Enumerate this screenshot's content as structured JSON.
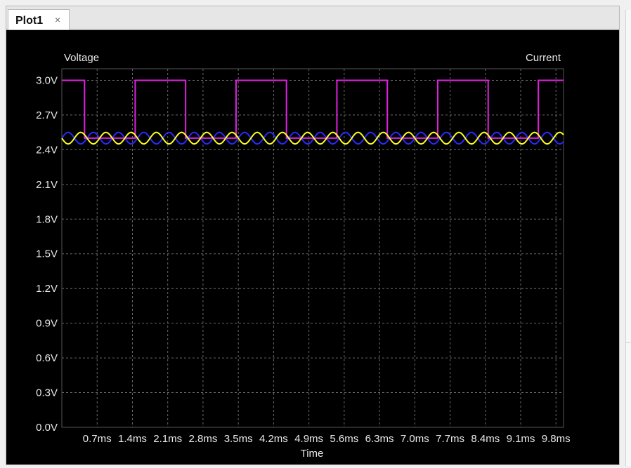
{
  "tab": {
    "label": "Plot1",
    "close_glyph": "×"
  },
  "chart_data": {
    "type": "line",
    "left_axis_label": "Voltage",
    "right_axis_label": "Current",
    "xlabel": "Time",
    "xlim": [
      0,
      9.95
    ],
    "ylim": [
      0,
      3.1
    ],
    "x_ticks": [
      0.7,
      1.4,
      2.1,
      2.8,
      3.5,
      4.2,
      4.9,
      5.6,
      6.3,
      7.0,
      7.7,
      8.4,
      9.1,
      9.8
    ],
    "x_tick_labels": [
      "0.7ms",
      "1.4ms",
      "2.1ms",
      "2.8ms",
      "3.5ms",
      "4.2ms",
      "4.9ms",
      "5.6ms",
      "6.3ms",
      "7.0ms",
      "7.7ms",
      "8.4ms",
      "9.1ms",
      "9.8ms"
    ],
    "y_ticks": [
      0,
      0.3,
      0.6,
      0.9,
      1.2,
      1.5,
      1.8,
      2.1,
      2.4,
      2.7,
      3.0
    ],
    "y_tick_labels": [
      "0.0V",
      "0.3V",
      "0.6V",
      "0.9V",
      "1.2V",
      "1.5V",
      "1.8V",
      "2.1V",
      "2.4V",
      "2.7V",
      "3.0V"
    ],
    "grid": true,
    "background": "#000000",
    "series": [
      {
        "color": "#e020e0",
        "kind": "pwm",
        "low": 2.5,
        "high": 3.0,
        "period": 2.0,
        "duty": 0.5,
        "phase": 1.45
      },
      {
        "color": "#2a2aff",
        "kind": "sine",
        "offset": 2.5,
        "amplitude": 0.05,
        "period": 0.5,
        "phase": 0.0
      },
      {
        "color": "#ffff20",
        "kind": "sine",
        "offset": 2.5,
        "amplitude": 0.05,
        "period": 0.5,
        "phase": 0.25
      }
    ]
  }
}
